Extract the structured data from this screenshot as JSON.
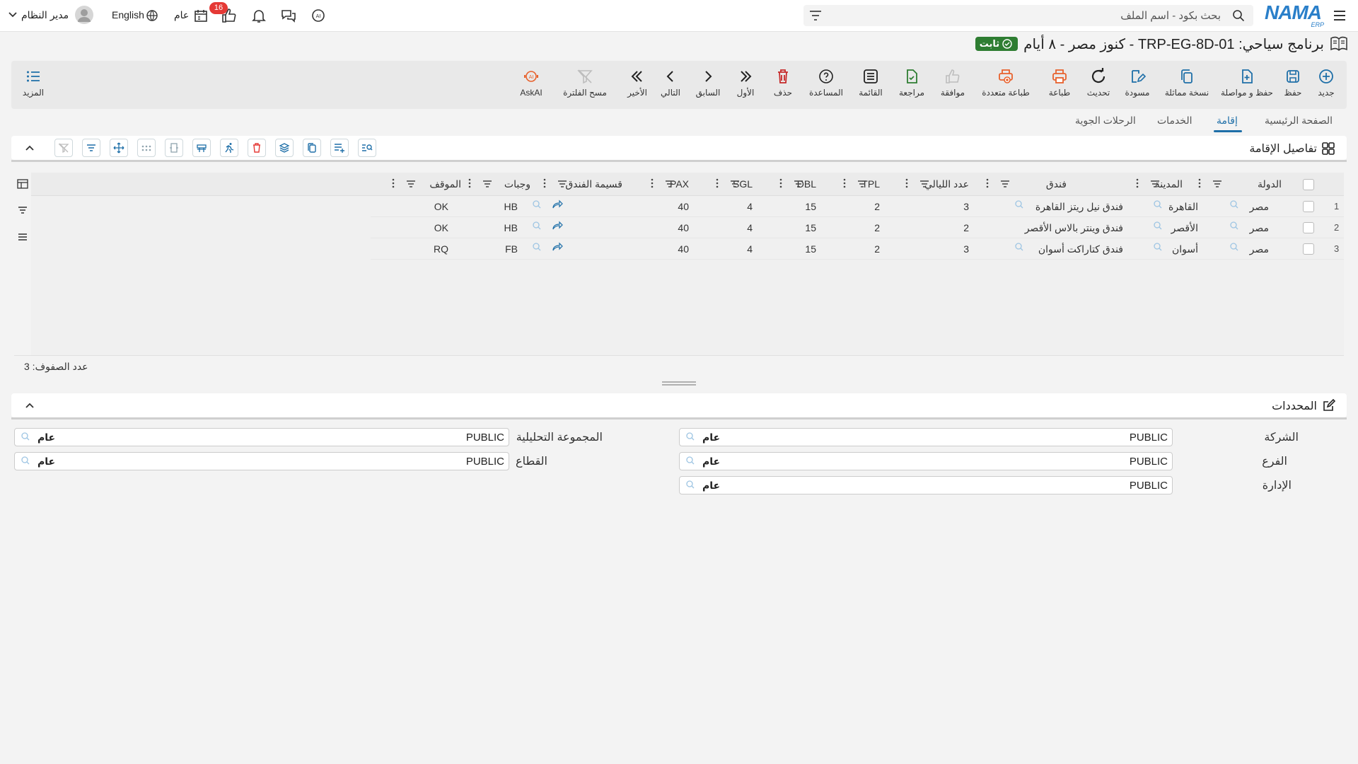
{
  "topbar": {
    "search_placeholder": "بحث بكود - اسم الملف",
    "logo_main": "NAMA",
    "logo_sub": "ERP",
    "notifications_count": "16",
    "public_label": "عام",
    "language_label": "English",
    "user_name": "مدير النظام"
  },
  "page": {
    "title": "برنامج سياحي: TRP-EG-8D-01 - كنوز مصر - ٨ أيام",
    "status": "ثابت"
  },
  "toolbar": {
    "new": "جديد",
    "save": "حفظ",
    "save_continue": "حفظ و مواصلة",
    "duplicate": "نسخة مماثلة",
    "draft": "مسودة",
    "refresh": "تحديث",
    "print": "طباعة",
    "multi_print": "طباعة متعددة",
    "approve": "موافقة",
    "review": "مراجعة",
    "list": "القائمة",
    "help": "المساعدة",
    "delete": "حذف",
    "first": "الأول",
    "previous": "السابق",
    "next": "التالي",
    "last": "الأخير",
    "clear_filter": "مسح الفلترة",
    "askai": "AskAI",
    "more": "المزيد"
  },
  "tabs": [
    "الصفحة الرئيسية",
    "إقامة",
    "الخدمات",
    "الرحلات الجوية"
  ],
  "accommodation": {
    "section_title": "تفاصيل الإقامة",
    "columns": [
      "الدولة",
      "المدينة",
      "فندق",
      "عدد الليالي",
      "TPL",
      "DBL",
      "SGL",
      "PAX",
      "قسيمة الفندق",
      "وجبات",
      "الموقف"
    ],
    "rows": [
      {
        "num": "1",
        "country": "مصر",
        "city": "القاهرة",
        "hotel": "فندق نيل ريتز القاهرة",
        "nights": "3",
        "tpl": "2",
        "dbl": "15",
        "sgl": "4",
        "pax": "40",
        "meals": "HB",
        "status": "OK"
      },
      {
        "num": "2",
        "country": "مصر",
        "city": "الأقصر",
        "hotel": "فندق وينتر بالاس الأقصر",
        "nights": "2",
        "tpl": "2",
        "dbl": "15",
        "sgl": "4",
        "pax": "40",
        "meals": "HB",
        "status": "OK"
      },
      {
        "num": "3",
        "country": "مصر",
        "city": "أسوان",
        "hotel": "فندق كتاراكت أسوان",
        "nights": "3",
        "tpl": "2",
        "dbl": "15",
        "sgl": "4",
        "pax": "40",
        "meals": "FB",
        "status": "RQ"
      }
    ],
    "row_count": "عدد الصفوف: 3"
  },
  "dimensions": {
    "section_title": "المحددات",
    "company_label": "الشركة",
    "company_value": "PUBLIC",
    "company_tag": "عام",
    "branch_label": "الفرع",
    "branch_value": "PUBLIC",
    "branch_tag": "عام",
    "department_label": "الإدارة",
    "department_value": "PUBLIC",
    "department_tag": "عام",
    "analysis_label": "المجموعة التحليلية",
    "analysis_value": "PUBLIC",
    "analysis_tag": "عام",
    "sector_label": "القطاع",
    "sector_value": "PUBLIC",
    "sector_tag": "عام"
  },
  "colors": {
    "accent": "#1e6fa8",
    "success": "#2e7d32",
    "danger": "#e53935",
    "print_orange": "#e8612c"
  }
}
